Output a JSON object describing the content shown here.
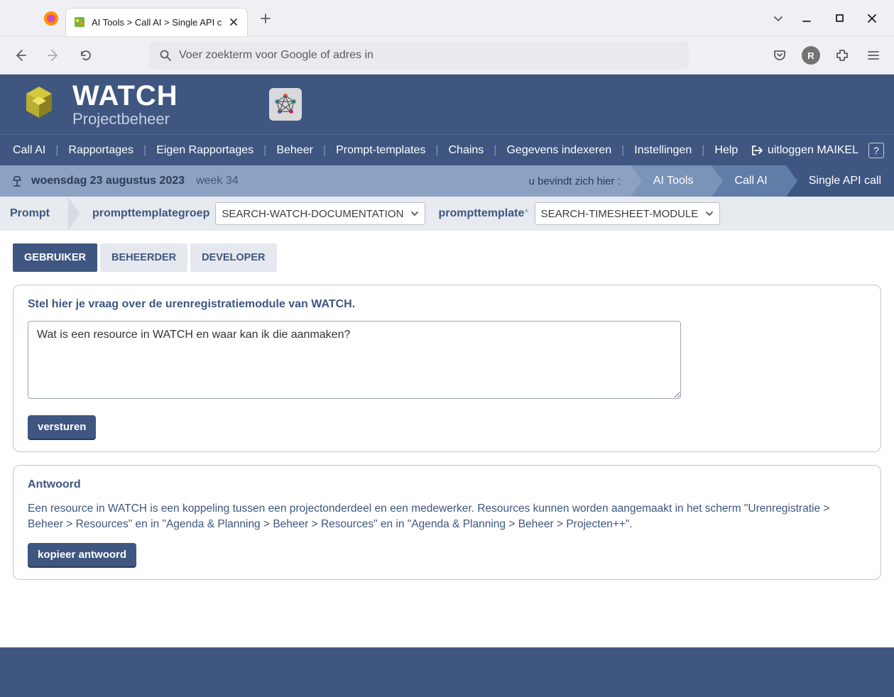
{
  "browser": {
    "tab_title": "AI Tools > Call AI > Single API c",
    "url_placeholder": "Voer zoekterm voor Google of adres in",
    "avatar_letter": "R"
  },
  "app_header": {
    "brand_line1": "WATCH",
    "brand_line2": "Projectbeheer"
  },
  "mainnav": {
    "items": [
      "Call AI",
      "Rapportages",
      "Eigen Rapportages",
      "Beheer",
      "Prompt-templates",
      "Chains",
      "Gegevens indexeren",
      "Instellingen",
      "Help"
    ],
    "logout_label": "uitloggen MAIKEL",
    "help_square": "?"
  },
  "subbar": {
    "date": "woensdag 23 augustus 2023",
    "week": "week 34",
    "location_label": "u bevindt zich hier :",
    "crumbs": [
      "AI Tools",
      "Call AI",
      "Single API call"
    ]
  },
  "filterbar": {
    "prompt_label": "Prompt",
    "group_label": "prompttemplategroep",
    "group_value": "SEARCH-WATCH-DOCUMENTATION",
    "template_label": "prompttemplate",
    "template_req": "*",
    "template_value": "SEARCH-TIMESHEET-MODULE"
  },
  "tabs": {
    "user": "GEBRUIKER",
    "admin": "BEHEERDER",
    "dev": "DEVELOPER"
  },
  "question_panel": {
    "heading": "Stel hier je vraag over de urenregistratiemodule van WATCH.",
    "value": "Wat is een resource in WATCH en waar kan ik die aanmaken?",
    "send_label": "versturen"
  },
  "answer_panel": {
    "heading": "Antwoord",
    "text": "Een resource in WATCH is een koppeling tussen een projectonderdeel en een medewerker. Resources kunnen worden aangemaakt in het scherm \"Urenregistratie > Beheer > Resources\" en in \"Agenda & Planning > Beheer > Resources\" en in \"Agenda & Planning > Beheer > Projecten++\".",
    "copy_label": "kopieer antwoord"
  }
}
